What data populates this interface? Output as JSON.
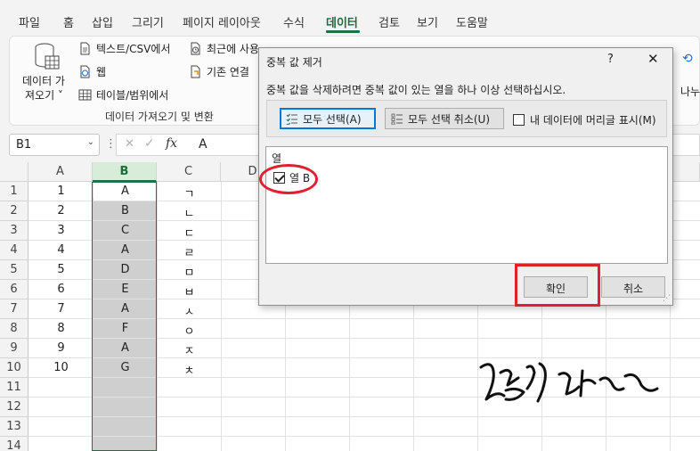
{
  "ribbon_tabs": [
    {
      "label": "파일",
      "active": false
    },
    {
      "label": "홈",
      "active": false
    },
    {
      "label": "삽입",
      "active": false
    },
    {
      "label": "그리기",
      "active": false
    },
    {
      "label": "페이지 레이아웃",
      "active": false
    },
    {
      "label": "수식",
      "active": false
    },
    {
      "label": "데이터",
      "active": true
    },
    {
      "label": "검토",
      "active": false
    },
    {
      "label": "보기",
      "active": false
    },
    {
      "label": "도움말",
      "active": false
    }
  ],
  "ribbon": {
    "get_data_line1": "데이터 가",
    "get_data_line2": "져오기 ˅",
    "text_csv": "텍스트/CSV에서",
    "web": "웹",
    "table_range": "테이블/범위에서",
    "recent_sources": "최근에 사용",
    "existing_conn": "기존 연결",
    "group_label": "데이터 가져오기 및 변환",
    "right_partial": "나누",
    "accent_color": "#1e7145"
  },
  "formula_bar": {
    "name_box": "B1",
    "formula_value": "A",
    "fx_label": "fx"
  },
  "sheet": {
    "columns": [
      "A",
      "B",
      "C",
      "D"
    ],
    "selected_column": "B",
    "rows": [
      {
        "num": "1",
        "a": "1",
        "b": "A",
        "c": "ㄱ"
      },
      {
        "num": "2",
        "a": "2",
        "b": "B",
        "c": "ㄴ"
      },
      {
        "num": "3",
        "a": "3",
        "b": "C",
        "c": "ㄷ"
      },
      {
        "num": "4",
        "a": "4",
        "b": "A",
        "c": "ㄹ"
      },
      {
        "num": "5",
        "a": "5",
        "b": "D",
        "c": "ㅁ"
      },
      {
        "num": "6",
        "a": "6",
        "b": "E",
        "c": "ㅂ"
      },
      {
        "num": "7",
        "a": "7",
        "b": "A",
        "c": "ㅅ"
      },
      {
        "num": "8",
        "a": "8",
        "b": "F",
        "c": "ㅇ"
      },
      {
        "num": "9",
        "a": "9",
        "b": "A",
        "c": "ㅈ"
      },
      {
        "num": "10",
        "a": "10",
        "b": "G",
        "c": "ㅊ"
      },
      {
        "num": "11",
        "a": "",
        "b": "",
        "c": ""
      },
      {
        "num": "12",
        "a": "",
        "b": "",
        "c": ""
      },
      {
        "num": "13",
        "a": "",
        "b": "",
        "c": ""
      },
      {
        "num": "14",
        "a": "",
        "b": "",
        "c": ""
      }
    ]
  },
  "dialog": {
    "title": "중복 값 제거",
    "help": "?",
    "close": "✕",
    "instruction": "중복 값을 삭제하려면 중복 값이 있는 열을 하나 이상 선택하십시오.",
    "select_all": "모두 선택(A)",
    "unselect_all": "모두 선택 취소(U)",
    "my_data_headers": "내 데이터에 머리글 표시(M)",
    "list_header": "열",
    "columns": [
      {
        "label": "열 B",
        "checked": true
      }
    ],
    "ok": "확인",
    "cancel": "취소"
  },
  "annotation_color": "#e0202c"
}
